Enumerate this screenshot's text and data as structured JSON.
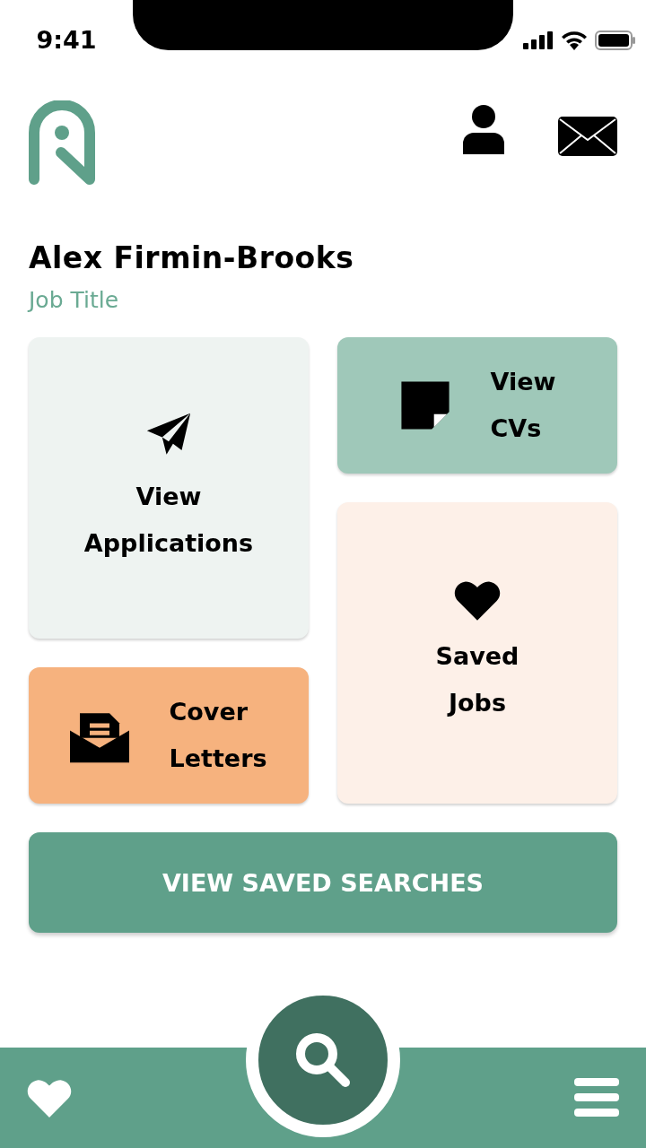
{
  "status_bar": {
    "time": "9:41"
  },
  "profile": {
    "name": "Alex Firmin-Brooks",
    "job_title": "Job Title"
  },
  "tiles": [
    {
      "label": "View Applications",
      "kind": "stacked",
      "color": "#eef3f1"
    },
    {
      "label": "View CVs",
      "kind": "inline",
      "color": "#9fc8b9"
    },
    {
      "label": "Saved Jobs",
      "kind": "stacked",
      "color": "#fdf0e8"
    },
    {
      "label": "Cover Letters",
      "kind": "inline",
      "color": "#f6b27e"
    }
  ],
  "primary_button": {
    "label": "VIEW SAVED SEARCHES"
  }
}
